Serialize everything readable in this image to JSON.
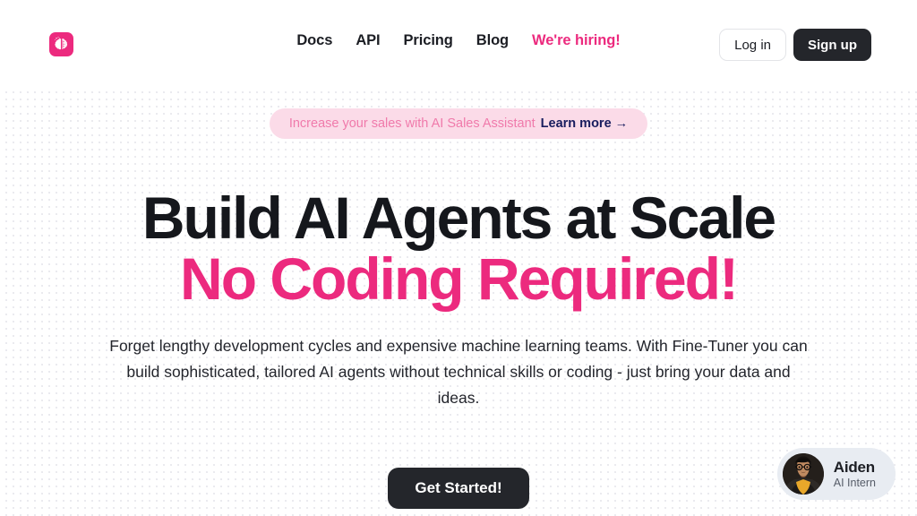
{
  "header": {
    "logo": {
      "icon": "brain-logo-icon",
      "color": "#ec2a7e"
    },
    "nav": [
      {
        "label": "Docs",
        "accent": false
      },
      {
        "label": "API",
        "accent": false
      },
      {
        "label": "Pricing",
        "accent": false
      },
      {
        "label": "Blog",
        "accent": false
      },
      {
        "label": "We're hiring!",
        "accent": true
      }
    ],
    "login_label": "Log in",
    "signup_label": "Sign up"
  },
  "announcement": {
    "text": "Increase your sales with AI Sales Assistant",
    "link_label": "Learn more →",
    "background": "#fbdbe8",
    "text_color": "#f07aab",
    "link_color": "#181c5e"
  },
  "hero": {
    "headline_line_1": "Build AI Agents at Scale",
    "headline_line_2": "No Coding Required!",
    "headline_accent_color": "#ec2a7e",
    "paragraph": "Forget lengthy development cycles and expensive machine learning teams. With Fine-Tuner you can build sophisticated, tailored AI agents without technical skills or coding - just bring your data and ideas.",
    "cta_label": "Get Started!"
  },
  "chat_widget": {
    "name": "Aiden",
    "role": "AI Intern",
    "avatar": "user-avatar-photo",
    "background": "#e8ecf2"
  }
}
